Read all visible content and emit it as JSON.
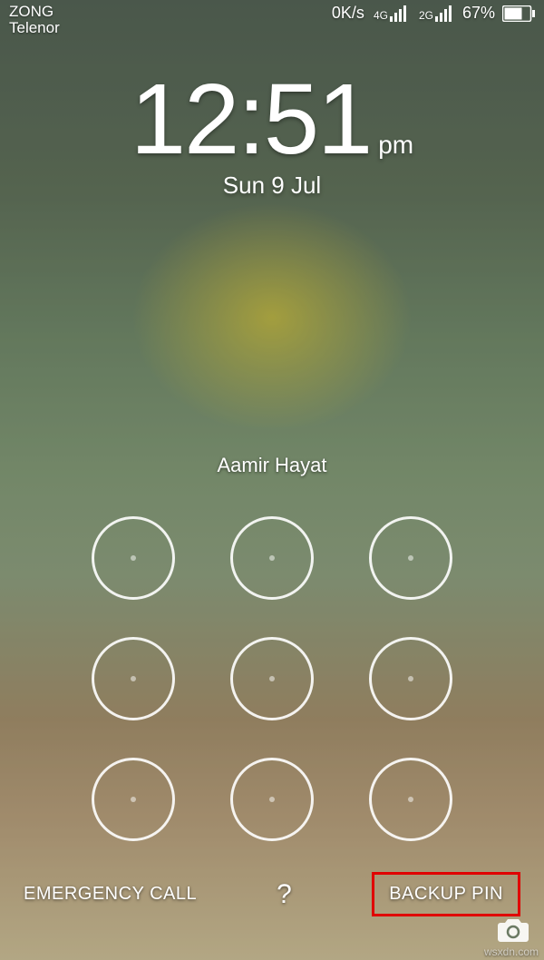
{
  "status": {
    "carrier1": "ZONG",
    "carrier2": "Telenor",
    "speed": "0K/s",
    "net1_label": "4G",
    "net2_label": "2G",
    "battery_text": "67%"
  },
  "clock": {
    "time": "12:51",
    "ampm": "pm",
    "date": "Sun 9 Jul"
  },
  "owner": "Aamir Hayat",
  "buttons": {
    "emergency": "EMERGENCY CALL",
    "help": "?",
    "backup_pin": "BACKUP PIN"
  },
  "attribution": "wsxdn.com"
}
